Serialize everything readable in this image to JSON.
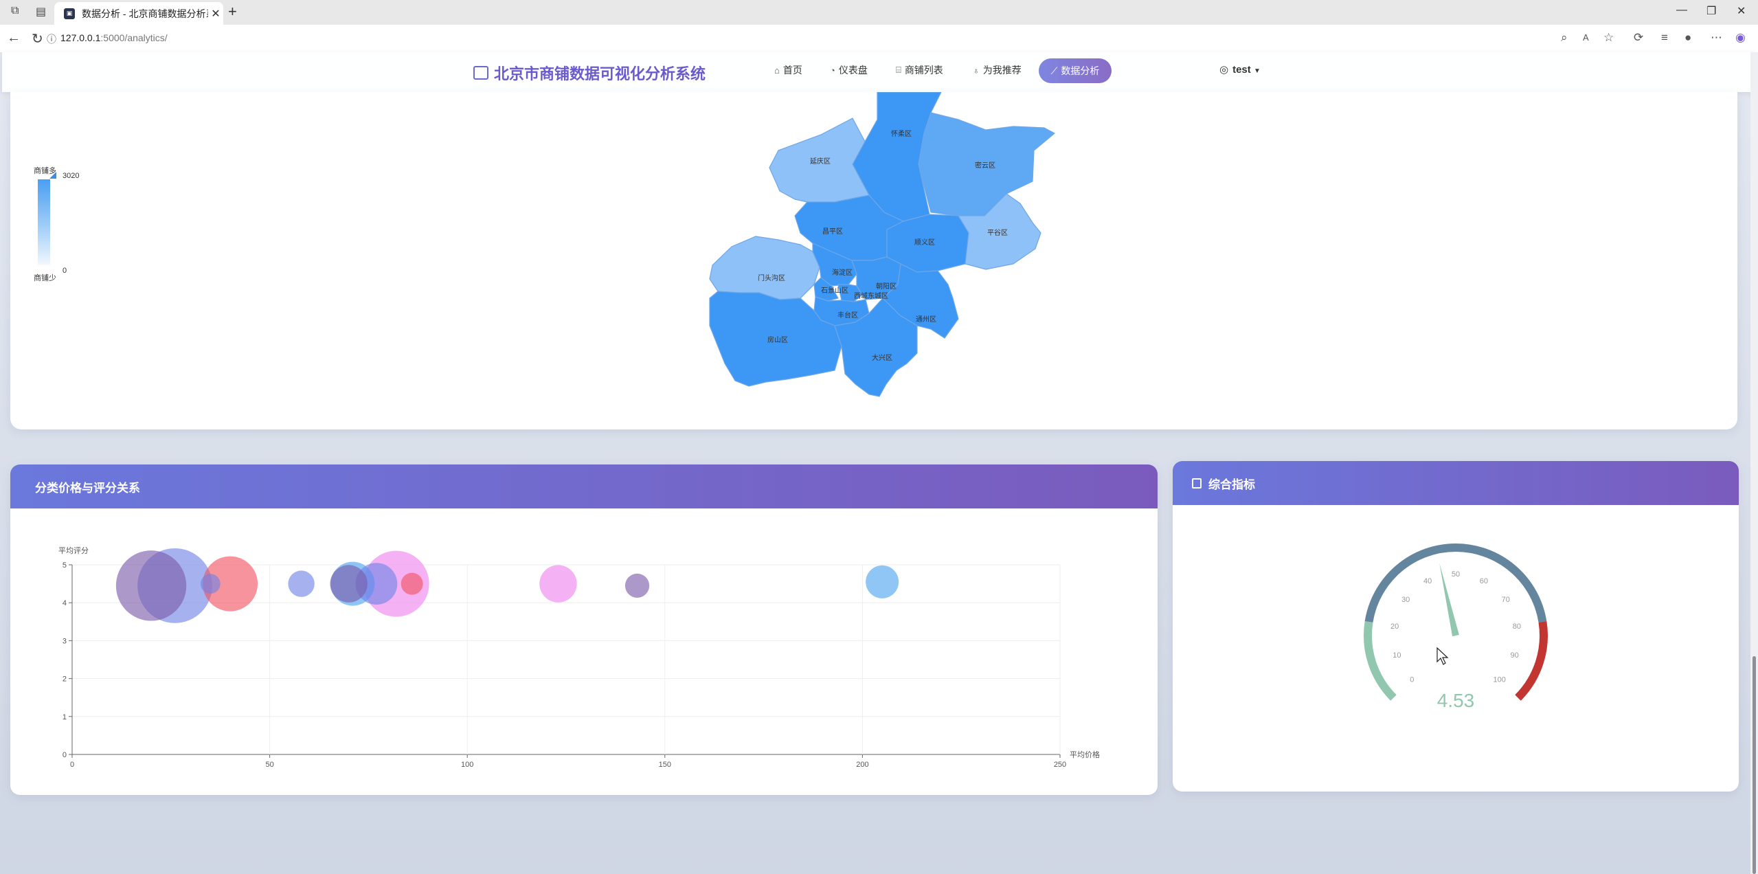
{
  "browser": {
    "tab_title": "数据分析 - 北京商铺数据分析系统",
    "url_host": "127.0.0.1",
    "url_rest": ":5000/analytics/"
  },
  "navbar": {
    "brand": "北京市商铺数据可视化分析系统",
    "items": [
      {
        "label": "首页",
        "icon": "home-icon"
      },
      {
        "label": "仪表盘",
        "icon": "dashboard-icon"
      },
      {
        "label": "商铺列表",
        "icon": "store-icon"
      },
      {
        "label": "为我推荐",
        "icon": "lightbulb-icon"
      }
    ],
    "active": {
      "label": "数据分析",
      "icon": "chart-icon"
    },
    "user": "test"
  },
  "map": {
    "legend_high": "商铺多",
    "legend_low": "商铺少",
    "legend_max": "3020",
    "legend_min": "0",
    "districts": [
      "怀柔区",
      "延庆区",
      "密云区",
      "昌平区",
      "顺义区",
      "平谷区",
      "门头沟区",
      "海淀区",
      "石景山区",
      "朝阳区",
      "西城东城区",
      "丰台区",
      "通州区",
      "房山区",
      "大兴区"
    ]
  },
  "bubble_panel": {
    "title": "分类价格与评分关系"
  },
  "gauge_panel": {
    "title": "综合指标",
    "value": "4.53",
    "value_num": 4.53,
    "ticks": [
      "0",
      "10",
      "20",
      "30",
      "40",
      "50",
      "60",
      "70",
      "80",
      "90",
      "100"
    ]
  },
  "chart_data": {
    "type": "scatter",
    "title": "",
    "xlabel": "平均价格",
    "ylabel": "平均评分",
    "xlim": [
      0,
      250
    ],
    "ylim": [
      0,
      5
    ],
    "x_ticks": [
      "0",
      "50",
      "100",
      "150",
      "200",
      "250"
    ],
    "y_ticks": [
      "0",
      "1",
      "2",
      "3",
      "4",
      "5"
    ],
    "points": [
      {
        "x": 20,
        "y": 4.45,
        "size": 32,
        "color": "#7b5ba8"
      },
      {
        "x": 26,
        "y": 4.45,
        "size": 34,
        "color": "#6f82e6"
      },
      {
        "x": 35,
        "y": 4.5,
        "size": 9,
        "color": "#6f82e6"
      },
      {
        "x": 40,
        "y": 4.5,
        "size": 25,
        "color": "#f05060"
      },
      {
        "x": 58,
        "y": 4.5,
        "size": 12,
        "color": "#6f82e6"
      },
      {
        "x": 70,
        "y": 4.5,
        "size": 17,
        "color": "#7b5ba8"
      },
      {
        "x": 71,
        "y": 4.5,
        "size": 20,
        "color": "#4aa3f0"
      },
      {
        "x": 77,
        "y": 4.5,
        "size": 19,
        "color": "#6f82e6"
      },
      {
        "x": 82,
        "y": 4.5,
        "size": 30,
        "color": "#ee82ee"
      },
      {
        "x": 86,
        "y": 4.5,
        "size": 10,
        "color": "#f05060"
      },
      {
        "x": 123,
        "y": 4.5,
        "size": 17,
        "color": "#ee82ee"
      },
      {
        "x": 143,
        "y": 4.45,
        "size": 11,
        "color": "#7b5ba8"
      },
      {
        "x": 205,
        "y": 4.55,
        "size": 15,
        "color": "#4aa3f0"
      }
    ]
  }
}
